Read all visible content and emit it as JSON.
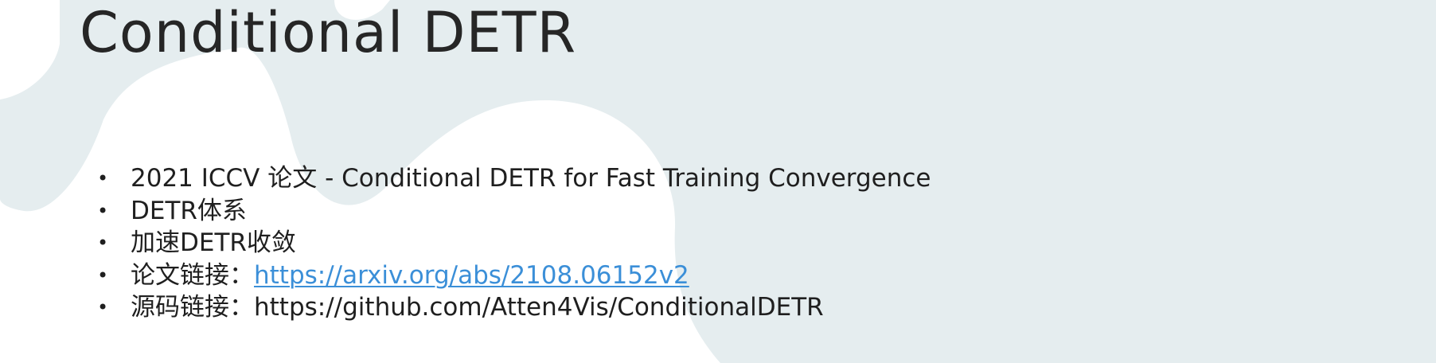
{
  "slide": {
    "title": "Conditional DETR",
    "bullet_symbol": "•",
    "bullets": [
      {
        "text": "2021 ICCV 论文 - Conditional DETR for Fast Training Convergence"
      },
      {
        "text": "DETR体系"
      },
      {
        "text": "加速DETR收敛"
      },
      {
        "prefix": "论文链接：",
        "link": "https://arxiv.org/abs/2108.06152v2"
      },
      {
        "prefix": "源码链接：",
        "text": "https://github.com/Atten4Vis/ConditionalDETR"
      }
    ]
  },
  "colors": {
    "background": "#ffffff",
    "shape": "#e5edef",
    "text": "#1f1f1f",
    "link": "#3b8fd8"
  }
}
